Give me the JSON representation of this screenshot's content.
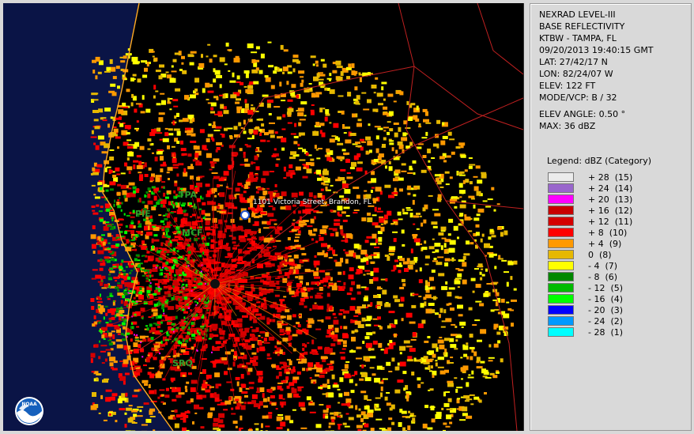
{
  "info": {
    "product": "NEXRAD LEVEL-III",
    "field": "BASE REFLECTIVITY",
    "station": "KTBW - TAMPA, FL",
    "datetime": "09/20/2013 19:40:15 GMT",
    "lat": "LAT: 27/42/17 N",
    "lon": "LON: 82/24/07 W",
    "elev": "ELEV: 122 FT",
    "mode": "MODE/VCP: B / 32",
    "elev_angle": "ELEV ANGLE: 0.50 °",
    "max": "MAX: 36 dBZ"
  },
  "legend": {
    "title": "Legend: dBZ (Category)",
    "items": [
      {
        "label": "+ 28  (15)",
        "color": "#ebebeb"
      },
      {
        "label": "+ 24  (14)",
        "color": "#9966cc"
      },
      {
        "label": "+ 20  (13)",
        "color": "#ff00ff"
      },
      {
        "label": "+ 16  (12)",
        "color": "#c80000"
      },
      {
        "label": "+ 12  (11)",
        "color": "#d40000"
      },
      {
        "label": "+ 8  (10)",
        "color": "#ff0000"
      },
      {
        "label": "+ 4  (9)",
        "color": "#ff9900"
      },
      {
        "label": "0  (8)",
        "color": "#e6b800"
      },
      {
        "label": "- 4  (7)",
        "color": "#ffff00"
      },
      {
        "label": "- 8  (6)",
        "color": "#008800"
      },
      {
        "label": "- 12  (5)",
        "color": "#00bb00"
      },
      {
        "label": "- 16  (4)",
        "color": "#00ff00"
      },
      {
        "label": "- 20  (3)",
        "color": "#0000ff"
      },
      {
        "label": "- 24  (2)",
        "color": "#0099ff"
      },
      {
        "label": "- 28  (1)",
        "color": "#00ffff"
      }
    ]
  },
  "map": {
    "address": "1101 Victoria Street, Brandon, FL",
    "cities": [
      "TPA",
      "PIE",
      "MCF",
      "SRQ"
    ],
    "logo_text": "NOAA",
    "colors": {
      "water": "#0a1446",
      "land": "#000000",
      "coast": "#ffaa22",
      "roads": "#c02020"
    }
  }
}
